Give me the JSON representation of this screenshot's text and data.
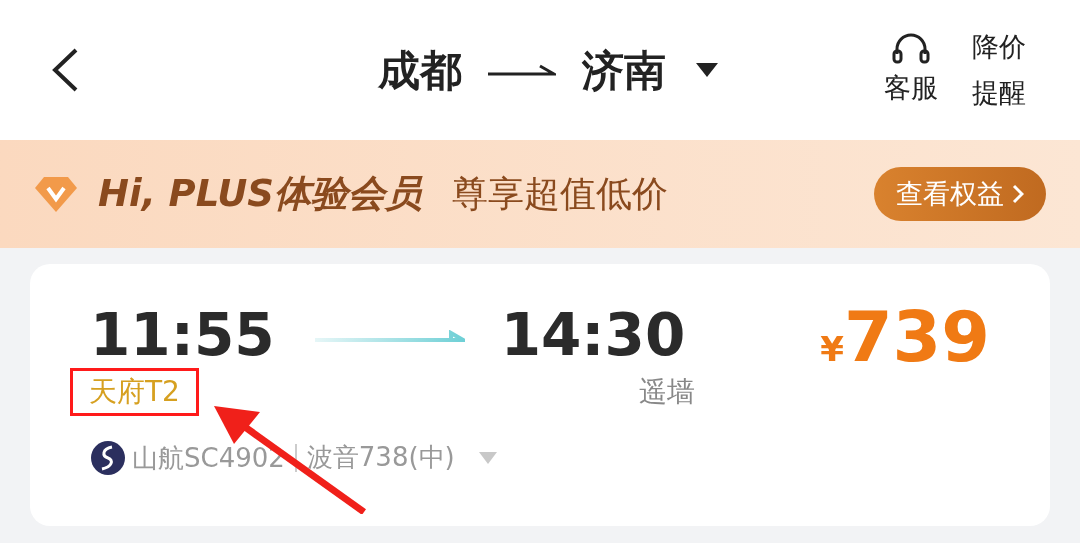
{
  "header": {
    "from": "成都",
    "to": "济南",
    "service": "客服",
    "price_alert": "降价提醒"
  },
  "banner": {
    "title": "Hi, PLUS体验会员",
    "subtitle": "尊享超值低价",
    "button": "查看权益"
  },
  "flight": {
    "departure_time": "11:55",
    "departure_terminal": "天府T2",
    "arrival_time": "14:30",
    "arrival_airport": "遥墙",
    "currency": "¥",
    "price": "739",
    "airline": "山航SC4902",
    "aircraft": "波音738(中)"
  }
}
